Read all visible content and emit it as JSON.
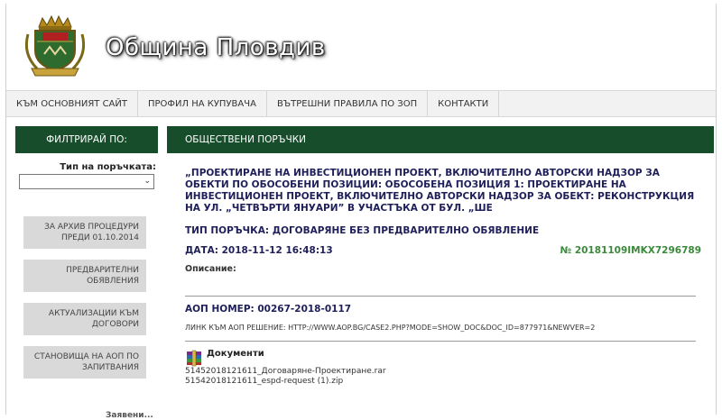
{
  "site": {
    "title": "Община Пловдив"
  },
  "nav": {
    "items": [
      {
        "label": "Към основният сайт"
      },
      {
        "label": "Профил на купувача"
      },
      {
        "label": "Вътрешни правила по ЗОП"
      },
      {
        "label": "Контакти"
      }
    ]
  },
  "sidebar": {
    "heading": "Филтрирай по:",
    "filter_label": "Тип на поръчката:",
    "filter_value": "",
    "buttons": [
      {
        "line1": "За архив процедури",
        "line2": "преди 01.10.2014"
      },
      {
        "line1": "Предварителни",
        "line2": "обявления"
      },
      {
        "line1": "Актуализации към",
        "line2": "договори"
      },
      {
        "line1": "Становища на АОП по",
        "line2": "запитвания"
      }
    ],
    "footer_label": "Заявени..."
  },
  "main": {
    "heading": "Обществени поръчки",
    "title": "„Проектиране на инвестиционен проект, включително авторски надзор за обекти по обособени позиции: Обособена позиция 1: Проектиране на инвестиционен проект, включително авторски надзор за обект: Реконструкция на ул. „Четвърти януари” в участъка от бул. „Ше",
    "procedure_type": "Тип поръчка: Договаряне без предварително обявление",
    "date": "Дата: 2018-11-12 16:48:13",
    "number": "№ 20181109IMKX7296789",
    "description_label": "Описание:",
    "aop_number": "АОП номер: 00267-2018-0117",
    "aop_link": "Линк към АОП решение: http://www.aop.bg/case2.php?mode=show_doc&doc_id=877971&newver=2",
    "documents_title": "Документи",
    "files": [
      "51452018121611_Договаряне-Проектиране.rar",
      "51542018121611_espd-request (1).zip"
    ]
  },
  "colors": {
    "header_green": "#174d2b",
    "number_green": "#3b8a3b",
    "title_blue": "#1f1f5a"
  }
}
